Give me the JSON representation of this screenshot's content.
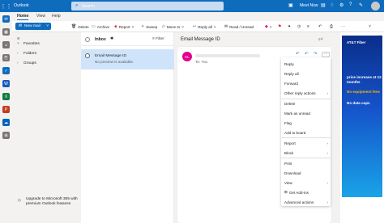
{
  "app": {
    "title": "Outlook"
  },
  "search": {
    "placeholder": "Search"
  },
  "topbar": {
    "meet_now": "Meet Now"
  },
  "ribbon": {
    "tabs": [
      "Home",
      "View",
      "Help"
    ],
    "new_mail": "New mail",
    "buttons": [
      "Delete",
      "Archive",
      "Report",
      "Sweep",
      "Move to",
      "Reply all",
      "Read / Unread"
    ]
  },
  "folders": {
    "items": [
      "Favorites",
      "Folders",
      "Groups"
    ],
    "upgrade_text": "Upgrade to Microsoft 365 with premium Outlook features"
  },
  "list": {
    "title": "Inbox",
    "filter": "Filter",
    "message": {
      "from": "Email Message ID",
      "preview": "No preview is available."
    }
  },
  "reading": {
    "subject": "Email Message ID",
    "avatar_initials": "KL",
    "to_label": "To: You"
  },
  "menu": {
    "items": [
      {
        "label": "Reply",
        "submenu": false
      },
      {
        "label": "Reply all",
        "submenu": false
      },
      {
        "label": "Forward",
        "submenu": false
      },
      {
        "label": "Other reply actions",
        "submenu": true
      },
      {
        "label": "Delete",
        "submenu": false
      },
      {
        "label": "Mark as unread",
        "submenu": false
      },
      {
        "label": "Flag",
        "submenu": false
      },
      {
        "label": "Add to board",
        "submenu": false
      },
      {
        "label": "Report",
        "submenu": true
      },
      {
        "label": "Block",
        "submenu": true
      },
      {
        "label": "Print",
        "submenu": false
      },
      {
        "label": "Download",
        "submenu": false
      },
      {
        "label": "View",
        "submenu": true
      },
      {
        "label": "Get Add-ins",
        "submenu": false
      },
      {
        "label": "Advanced actions",
        "submenu": true
      }
    ]
  },
  "ad": {
    "brand": "AT&T Fiber",
    "headline": "price increase at 12 months",
    "offer": "No equipment fees",
    "tagline": "No data caps"
  },
  "colors": {
    "accent": "#0f6cbd",
    "selected_row": "#cfe4fa",
    "avatar": "#e3008c"
  }
}
